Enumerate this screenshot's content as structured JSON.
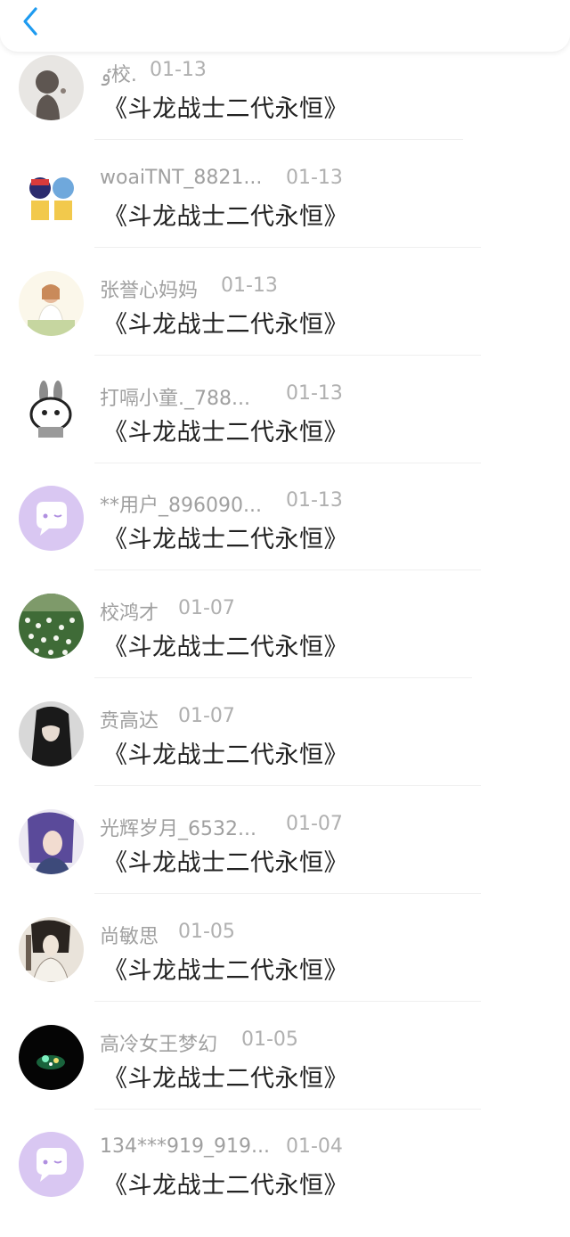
{
  "header": {
    "back_icon": "chevron-left-icon",
    "accent": "#1e9bf0"
  },
  "comments": [
    {
      "name": "ٶ校.",
      "date": "01-13",
      "text": "《斗龙战士二代永恒》",
      "avatar": "silhouette"
    },
    {
      "name": "woaiTNT_8821...",
      "date": "01-13",
      "text": "《斗龙战士二代永恒》",
      "avatar": "cartoon-duo"
    },
    {
      "name": "张誉心妈妈",
      "date": "01-13",
      "text": "《斗龙战士二代永恒》",
      "avatar": "girl-photo"
    },
    {
      "name": "打嗝小童._788...",
      "date": "01-13",
      "text": "《斗龙战士二代永恒》",
      "avatar": "bunny"
    },
    {
      "name": "**用户_896090...",
      "date": "01-13",
      "text": "《斗龙战士二代永恒》",
      "avatar": "default-chat"
    },
    {
      "name": "校鸿才",
      "date": "01-07",
      "text": "《斗龙战士二代永恒》",
      "avatar": "flowers"
    },
    {
      "name": "贲高达",
      "date": "01-07",
      "text": "《斗龙战士二代永恒》",
      "avatar": "dark-hair"
    },
    {
      "name": "光辉岁月_6532...",
      "date": "01-07",
      "text": "《斗龙战士二代永恒》",
      "avatar": "anime-purple"
    },
    {
      "name": "尚敏思",
      "date": "01-05",
      "text": "《斗龙战士二代永恒》",
      "avatar": "ink-portrait"
    },
    {
      "name": "高冷女王梦幻",
      "date": "01-05",
      "text": "《斗龙战士二代永恒》",
      "avatar": "night-glow"
    },
    {
      "name": "134***919_919...",
      "date": "01-04",
      "text": "《斗龙战士二代永恒》",
      "avatar": "default-chat"
    }
  ]
}
